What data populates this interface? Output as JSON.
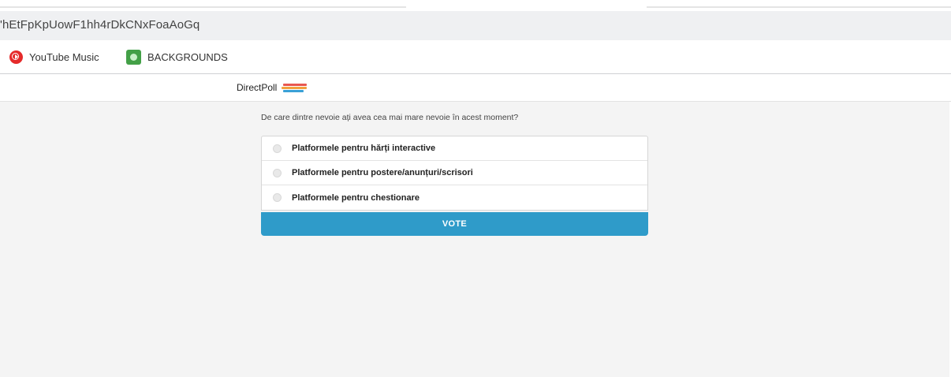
{
  "browser": {
    "address_text": "'hEtFpKpUowF1hh4rDkCNxFoaAoGq",
    "bookmarks": [
      {
        "label": "YouTube Music",
        "icon": "youtube-music-icon",
        "color": "#e52a2a"
      },
      {
        "label": "BACKGROUNDS",
        "icon": "backgrounds-icon",
        "color": "#43a047"
      }
    ]
  },
  "site": {
    "brand": "DirectPoll",
    "brand_flag_colors": [
      "#e8574f",
      "#f2a03d",
      "#3aa0d6",
      "#3aa0d6"
    ]
  },
  "poll": {
    "question": "De care dintre nevoie ați avea cea mai mare nevoie în acest moment?",
    "options": [
      {
        "label": "Platformele pentru hărți interactive",
        "selected": false
      },
      {
        "label": "Platformele pentru postere/anunțuri/scrisori",
        "selected": false
      },
      {
        "label": "Platformele pentru chestionare",
        "selected": false
      }
    ],
    "vote_label": "VOTE",
    "accent_color": "#2f9bc9"
  }
}
